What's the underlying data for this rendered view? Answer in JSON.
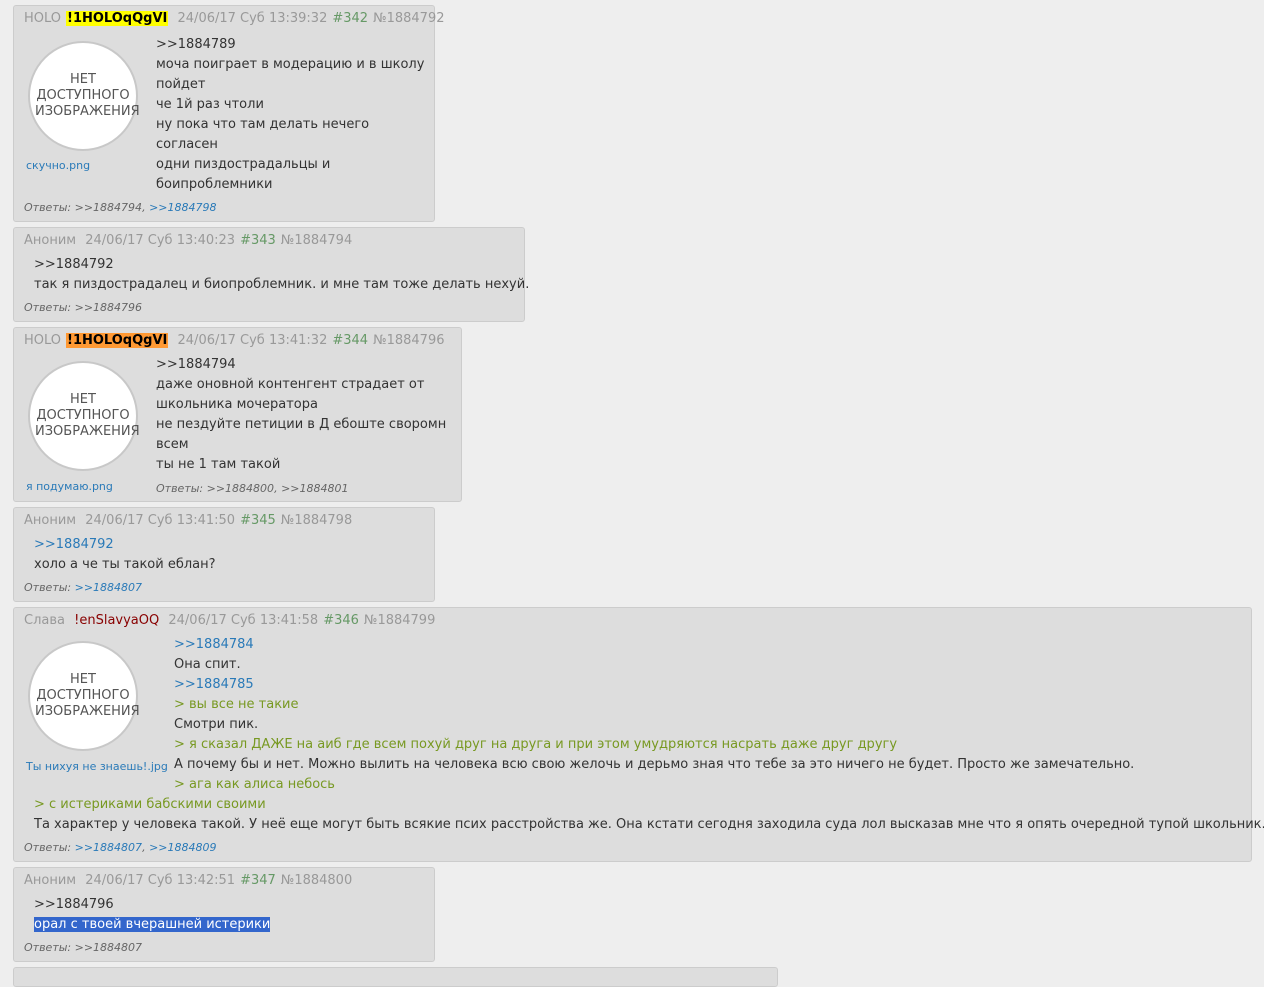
{
  "no_image_text": "НЕТ ДОСТУПНОГО ИЗОБРАЖЕНИЯ",
  "replies_label": "Ответы:",
  "posts": [
    {
      "name": "HOLO",
      "trip": "!1HOLOqQgVI",
      "date": "24/06/17 Суб 13:39:32",
      "num": "#342",
      "id": "№1884792",
      "file": "скучно.png",
      "lines": [
        ">>1884789",
        "моча поиграет в модерацию и в школу",
        "пойдет",
        "че 1й раз чтоли",
        "ну пока что там делать нечего",
        "согласен",
        "одни пиздострадальцы и",
        "боипроблемники"
      ],
      "replies": [
        ">>1884794",
        ">>1884798"
      ]
    },
    {
      "name": "Аноним",
      "date": "24/06/17 Суб 13:40:23",
      "num": "#343",
      "id": "№1884794",
      "lines": [
        ">>1884792",
        "так я пиздострадалец и биопроблемник. и мне там тоже делать нехуй."
      ],
      "replies": [
        ">>1884796"
      ]
    },
    {
      "name": "HOLO",
      "trip": "!1HOLOqQgVI",
      "date": "24/06/17 Суб 13:41:32",
      "num": "#344",
      "id": "№1884796",
      "file": "я подумаю.png",
      "lines": [
        ">>1884794",
        "даже оновной контенгент страдает от",
        "школьника мочератора",
        "не пездуйте петиции в Д ебоште своромн",
        "всем",
        "ты не 1 там такой"
      ],
      "replies": [
        ">>1884800",
        ">>1884801"
      ]
    },
    {
      "name": "Аноним",
      "date": "24/06/17 Суб 13:41:50",
      "num": "#345",
      "id": "№1884798",
      "lines": [
        ">>1884792",
        "холо а че ты такой еблан?"
      ],
      "replies": [
        ">>1884807"
      ]
    },
    {
      "name": "Слава",
      "trip": "!enSlavyaOQ",
      "date": "24/06/17 Суб 13:41:58",
      "num": "#346",
      "id": "№1884799",
      "file": "Ты нихуя не знаешь!.jpg",
      "lines": [
        ">>1884784",
        "Она спит.",
        ">>1884785",
        "> вы все не такие",
        "Смотри пик.",
        "> я сказал ДАЖЕ на аиб где всем похуй друг на друга и при этом умудряются насрать даже друг другу",
        "А почему бы и нет. Можно вылить на человека всю свою желочь и дерьмо зная что тебе за это ничего не будет. Просто же замечательно.",
        "> ага как алиса небось",
        "> с истериками бабскими своими",
        "Та характер у человека такой. У неё еще могут быть всякие псих расстройства же. Она кстати сегодня заходила суда лол высказав мне что я опять очередной тупой школьник. Мда."
      ],
      "replies": [
        ">>1884807",
        ">>1884809"
      ]
    },
    {
      "name": "Аноним",
      "date": "24/06/17 Суб 13:42:51",
      "num": "#347",
      "id": "№1884800",
      "lines": [
        ">>1884796",
        "орал с твоей вчерашней истерики"
      ],
      "replies": [
        ">>1884807"
      ]
    }
  ]
}
